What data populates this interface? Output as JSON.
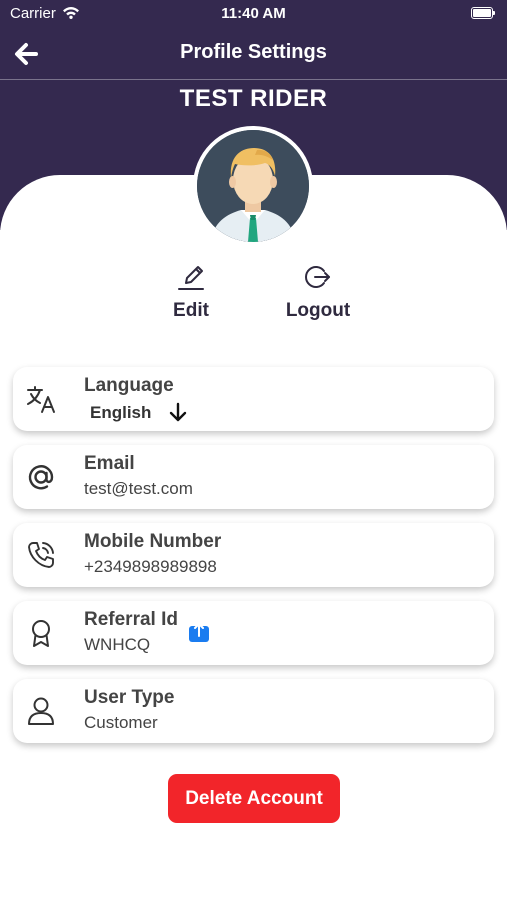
{
  "status_bar": {
    "carrier": "Carrier",
    "time": "11:40 AM"
  },
  "header": {
    "title": "Profile Settings",
    "user_name": "TEST RIDER",
    "back_icon": "arrow-left-icon"
  },
  "actions": {
    "edit_label": "Edit",
    "logout_label": "Logout"
  },
  "fields": [
    {
      "icon": "translate-icon",
      "title": "Language",
      "value": "English"
    },
    {
      "icon": "at-sign-icon",
      "title": "Email",
      "value": "test@test.com"
    },
    {
      "icon": "phone-icon",
      "title": "Mobile Number",
      "value": "+2349898989898"
    },
    {
      "icon": "ribbon-award-icon",
      "title": "Referral Id",
      "value": "WNHCQ"
    },
    {
      "icon": "user-icon",
      "title": "User Type",
      "value": "Customer"
    }
  ],
  "delete_button": {
    "label": "Delete Account"
  },
  "colors": {
    "header_bg": "#34294f",
    "delete_bg": "#f2252a",
    "share_blue": "#1a7cf0"
  }
}
